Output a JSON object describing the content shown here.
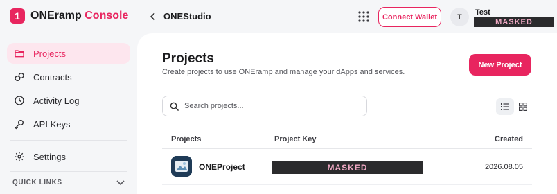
{
  "brand": {
    "prefix": "ONEramp",
    "accent": "Console",
    "logo_char": "1",
    "color": "#e8255f"
  },
  "sidebar": {
    "items": [
      {
        "label": "Projects",
        "icon": "folder-icon",
        "active": true
      },
      {
        "label": "Contracts",
        "icon": "contracts-icon",
        "active": false
      },
      {
        "label": "Activity Log",
        "icon": "clock-icon",
        "active": false
      },
      {
        "label": "API Keys",
        "icon": "key-icon",
        "active": false
      },
      {
        "label": "Settings",
        "icon": "gear-icon",
        "active": false
      }
    ],
    "quick_links": "QUICK LINKS"
  },
  "topbar": {
    "breadcrumb": "ONEStudio",
    "connect_wallet": "Connect Wallet",
    "user": {
      "initial": "T",
      "name": "Test",
      "masked": "MASKED"
    }
  },
  "main": {
    "title": "Projects",
    "subtitle": "Create projects to use ONEramp and manage your dApps and services.",
    "new_project": "New Project",
    "search_placeholder": "Search projects...",
    "table": {
      "headers": {
        "projects": "Projects",
        "key": "Project Key",
        "created": "Created"
      },
      "rows": [
        {
          "name": "ONEProject",
          "key": "MASKED",
          "created": "2026.08.05"
        }
      ]
    }
  }
}
